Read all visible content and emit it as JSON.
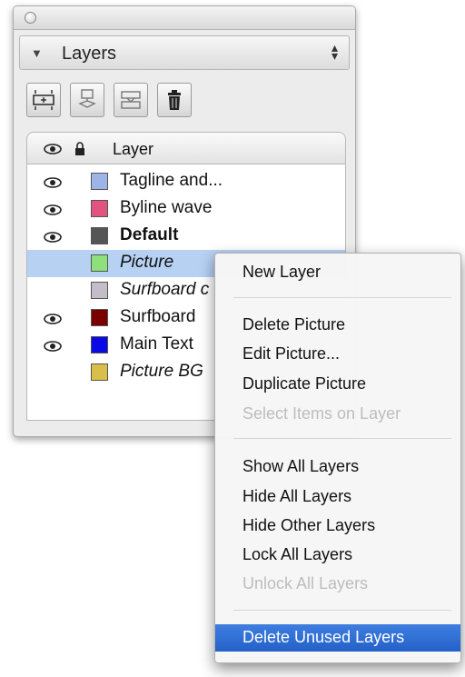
{
  "panel": {
    "title": "Layers",
    "column_label": "Layer"
  },
  "layers": [
    {
      "name": "Tagline and...",
      "color": "#9db4e8",
      "visible": true,
      "italic": false,
      "bold": false,
      "selected": false
    },
    {
      "name": "Byline wave",
      "color": "#e0547f",
      "visible": true,
      "italic": false,
      "bold": false,
      "selected": false
    },
    {
      "name": "Default",
      "color": "#555555",
      "visible": true,
      "italic": false,
      "bold": true,
      "selected": false
    },
    {
      "name": "Picture",
      "color": "#8ee07a",
      "visible": false,
      "italic": true,
      "bold": false,
      "selected": true
    },
    {
      "name": "Surfboard c",
      "color": "#c4bcc8",
      "visible": false,
      "italic": true,
      "bold": false,
      "selected": false
    },
    {
      "name": "Surfboard",
      "color": "#7a0000",
      "visible": true,
      "italic": false,
      "bold": false,
      "selected": false
    },
    {
      "name": "Main Text",
      "color": "#0a0ae6",
      "visible": true,
      "italic": false,
      "bold": false,
      "selected": false
    },
    {
      "name": "Picture BG",
      "color": "#d9bf4a",
      "visible": false,
      "italic": true,
      "bold": false,
      "selected": false
    }
  ],
  "context_menu": {
    "new_layer": "New Layer",
    "delete_picture": "Delete Picture",
    "edit_picture": "Edit Picture...",
    "duplicate_picture": "Duplicate Picture",
    "select_items": "Select Items on Layer",
    "show_all": "Show All Layers",
    "hide_all": "Hide All Layers",
    "hide_other": "Hide Other Layers",
    "lock_all": "Lock All Layers",
    "unlock_all": "Unlock All Layers",
    "delete_unused": "Delete Unused Layers"
  },
  "colors": {
    "selection_row": "#b7d1f3",
    "menu_highlight": "#2f6fd6"
  }
}
